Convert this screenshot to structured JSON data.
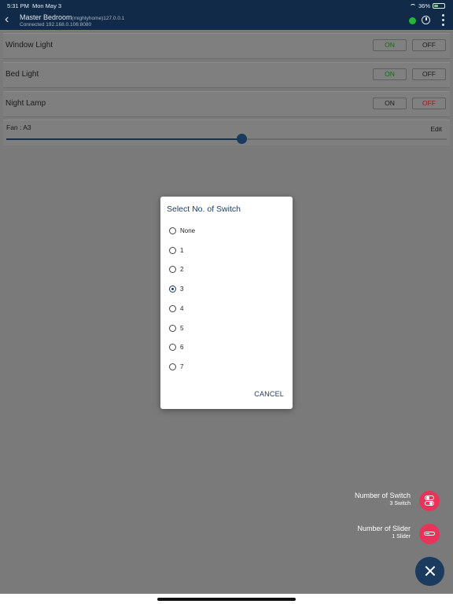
{
  "status_bar": {
    "time": "5:31 PM",
    "date": "Mon May 3",
    "battery": "36%"
  },
  "header": {
    "room": "Master Bedroom",
    "host": "(mightyhome)127.0.0.1",
    "connection": "Connected 192.168.0.106:8080",
    "status_color": "#27b43a"
  },
  "switches": [
    {
      "name": "Window Light",
      "on_label": "ON",
      "off_label": "OFF",
      "state": "on"
    },
    {
      "name": "Bed Light",
      "on_label": "ON",
      "off_label": "OFF",
      "state": "on"
    },
    {
      "name": "Night Lamp",
      "on_label": "ON",
      "off_label": "OFF",
      "state": "off"
    }
  ],
  "fan": {
    "label": "Fan : A3",
    "edit_label": "Edit",
    "level_fraction": 0.535
  },
  "dialog": {
    "title": "Select No. of Switch",
    "options": [
      "None",
      "1",
      "2",
      "3",
      "4",
      "5",
      "6",
      "7"
    ],
    "selected": "3",
    "cancel_label": "CANCEL"
  },
  "fab_menu": {
    "switch_title": "Number of Switch",
    "switch_sub": "3 Switch",
    "slider_title": "Number of Slider",
    "slider_sub": "1 Slider",
    "accent_color": "#e8345a",
    "main_color": "#1a3a5e"
  }
}
